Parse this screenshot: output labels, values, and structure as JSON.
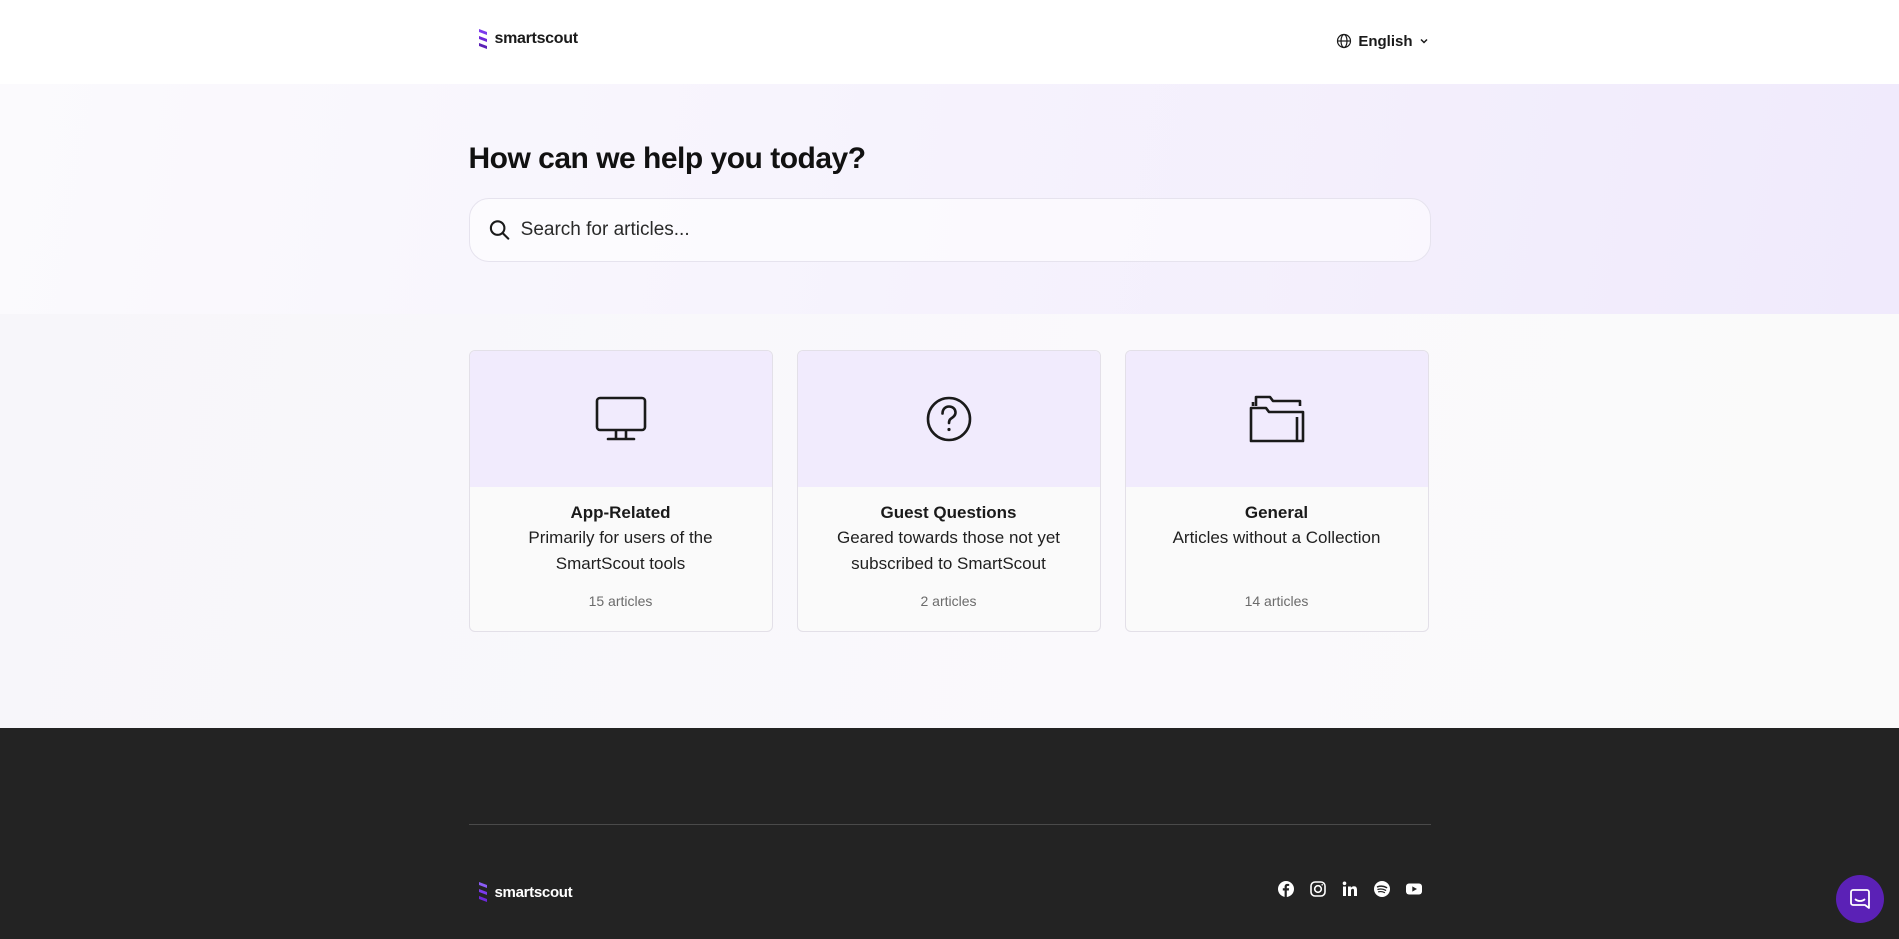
{
  "header": {
    "brand": "smartscout",
    "language": "English"
  },
  "hero": {
    "title": "How can we help you today?",
    "search_placeholder": "Search for articles..."
  },
  "collections": [
    {
      "icon": "monitor-icon",
      "title": "App-Related",
      "description": "Primarily for users of the SmartScout tools",
      "count": "15 articles"
    },
    {
      "icon": "question-circle-icon",
      "title": "Guest Questions",
      "description": "Geared towards those not yet subscribed to SmartScout",
      "count": "2 articles"
    },
    {
      "icon": "folder-icon",
      "title": "General",
      "description": "Articles without a Collection",
      "count": "14 articles"
    }
  ],
  "footer": {
    "brand": "smartscout",
    "socials": [
      "facebook-icon",
      "instagram-icon",
      "linkedin-icon",
      "spotify-icon",
      "youtube-icon"
    ]
  },
  "colors": {
    "brand_purple": "#5b21b6",
    "card_header": "#f1ebfd",
    "footer_bg": "#232323"
  }
}
